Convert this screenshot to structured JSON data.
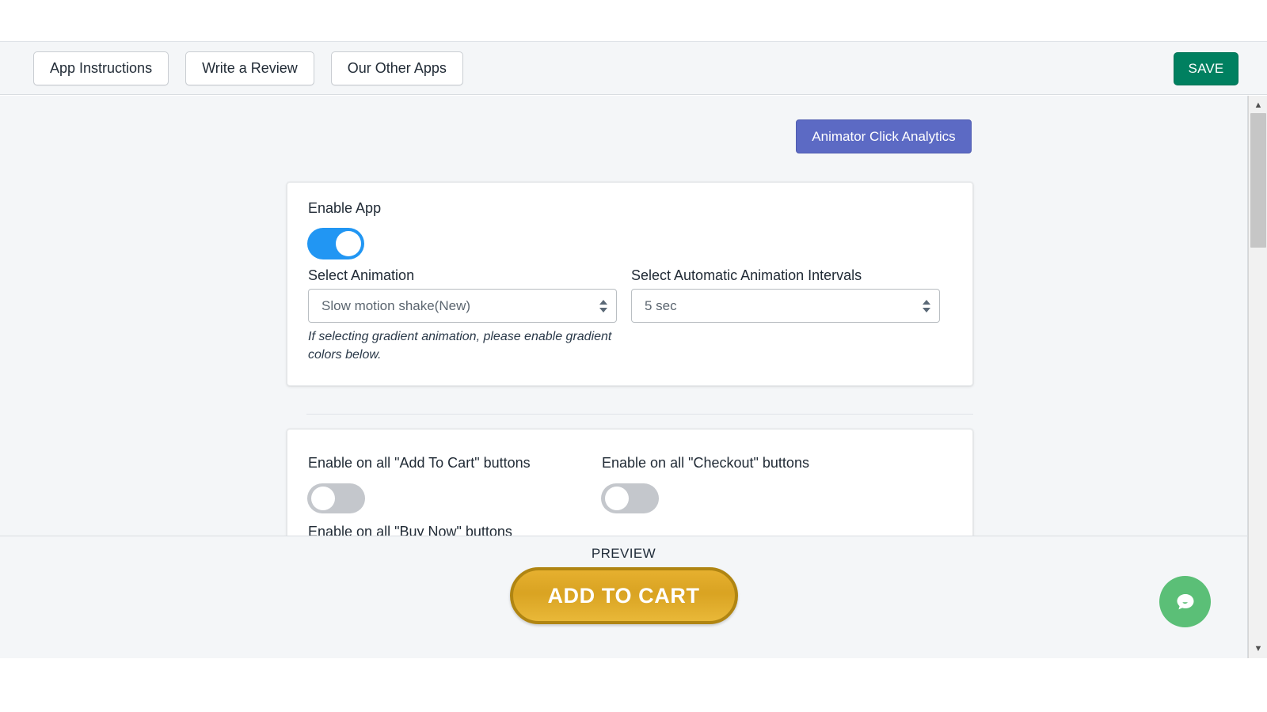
{
  "toolbar": {
    "buttons": [
      {
        "label": "App Instructions",
        "name": "app-instructions-button"
      },
      {
        "label": "Write a Review",
        "name": "write-a-review-button"
      },
      {
        "label": "Our Other Apps",
        "name": "our-other-apps-button"
      }
    ],
    "save_label": "SAVE",
    "save_color": "#008060"
  },
  "analytics": {
    "label": "Animator Click Analytics",
    "color": "#5c6ac4"
  },
  "general_card": {
    "enable_app_label": "Enable App",
    "enable_app_state": "on",
    "enable_app_color": "#2196f3",
    "select_animation_label": "Select Animation",
    "select_animation_value": "Slow motion shake(New)",
    "helper_text": "If selecting gradient animation, please enable gradient colors below.",
    "interval_label": "Select Automatic Animation Intervals",
    "interval_value": "5 sec"
  },
  "buttons_card": {
    "add_to_cart_label": "Enable on all \"Add To Cart\" buttons",
    "add_to_cart_state": "off",
    "checkout_label": "Enable on all \"Checkout\" buttons",
    "checkout_state": "off",
    "buy_now_label": "Enable on all \"Buy Now\" buttons"
  },
  "preview": {
    "label": "PREVIEW",
    "button_label": "ADD TO CART",
    "button_color": "#d9a322",
    "button_border_color": "#b08512"
  },
  "chat": {
    "icon": "chat-bubble-icon",
    "color": "#5bbf77"
  },
  "scrollbar": {
    "up_arrow": "▲",
    "down_arrow": "▼"
  }
}
